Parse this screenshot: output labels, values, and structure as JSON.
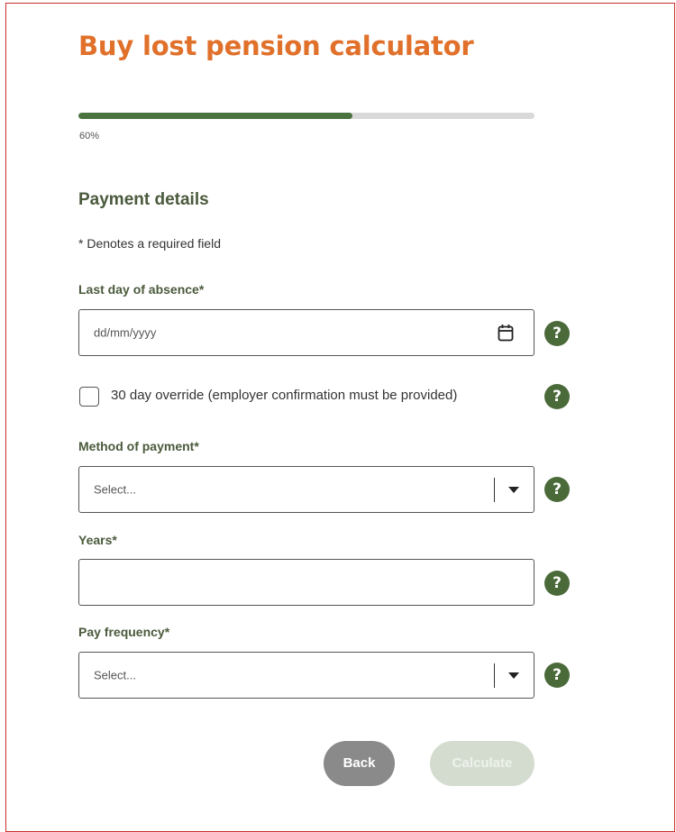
{
  "page": {
    "title": "Buy lost pension calculator"
  },
  "progress": {
    "value": 0.6,
    "label": "60%"
  },
  "section": {
    "heading": "Payment details",
    "required_note": "* Denotes a required field"
  },
  "fields": {
    "last_day": {
      "label": "Last day of absence*",
      "placeholder": "dd/mm/yyyy",
      "icon": "calendar-icon"
    },
    "override": {
      "label": "30 day override (employer confirmation must be provided)",
      "checked": false
    },
    "method": {
      "label": "Method of payment*",
      "selected": "Select..."
    },
    "years": {
      "label": "Years*",
      "value": ""
    },
    "frequency": {
      "label": "Pay frequency*",
      "selected": "Select..."
    }
  },
  "help": {
    "glyph": "?",
    "icon": "help-icon"
  },
  "buttons": {
    "back": "Back",
    "calculate": "Calculate"
  },
  "colors": {
    "title": "#e0702a",
    "accent": "#4a7340",
    "label": "#4a5a3c",
    "back_button": "#8a8a8a",
    "calculate_button_disabled": "#d4dccf"
  }
}
